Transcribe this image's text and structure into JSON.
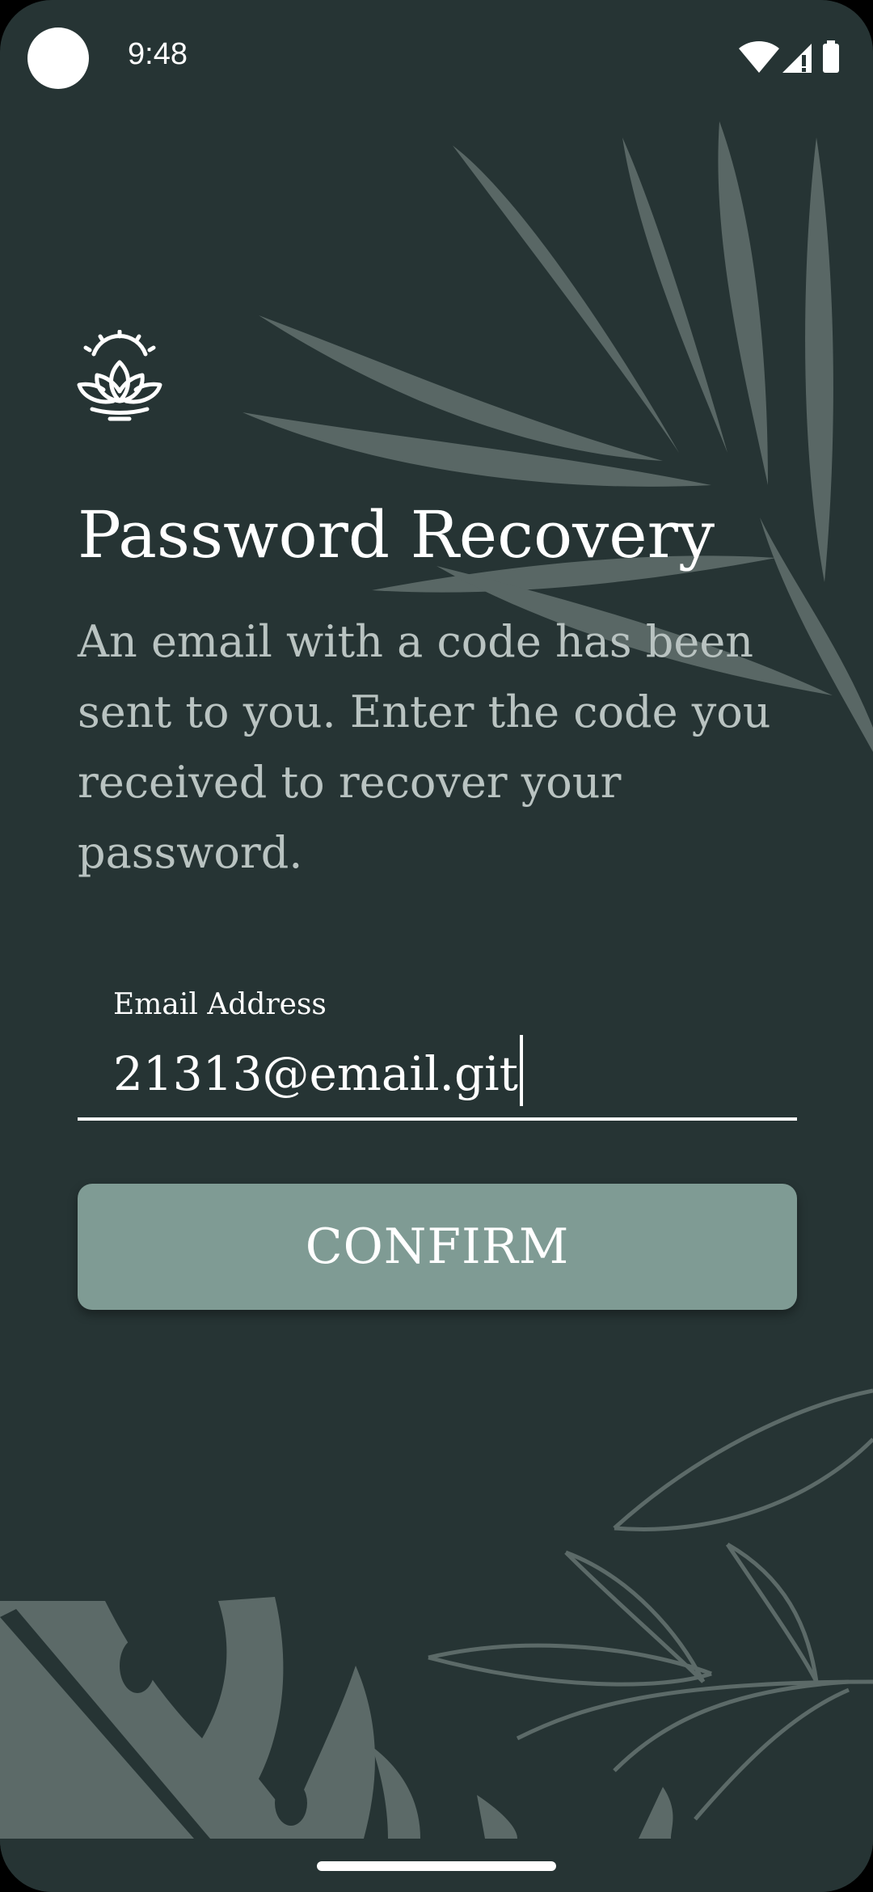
{
  "status_bar": {
    "time": "9:48",
    "icons": [
      "wifi-icon",
      "signal-icon",
      "battery-icon"
    ]
  },
  "logo": {
    "icon": "lotus-sunrise-icon"
  },
  "header": {
    "title": "Password Recovery",
    "subtitle": "An email with a code has been sent to you. Enter the code you received to recover your password."
  },
  "form": {
    "email_label": "Email Address",
    "email_value": "21313@email.git"
  },
  "actions": {
    "confirm_label": "CONFIRM"
  },
  "colors": {
    "background": "#263434",
    "button": "#7f9b94",
    "leaf": "#5c6a68",
    "text": "#ffffff",
    "muted_text": "#b9c3c1"
  }
}
